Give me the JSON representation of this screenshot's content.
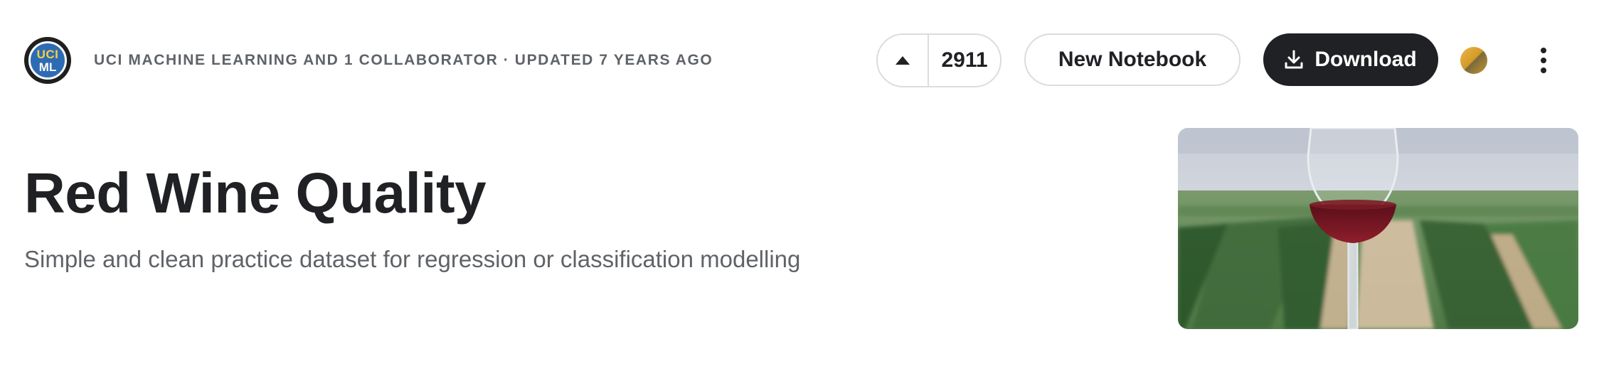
{
  "header": {
    "logo_line1": "UCI",
    "logo_line2": "ML",
    "meta": "UCI MACHINE LEARNING AND 1 COLLABORATOR · UPDATED 7 YEARS AGO"
  },
  "actions": {
    "upvote_count": "2911",
    "new_notebook_label": "New Notebook",
    "download_label": "Download"
  },
  "dataset": {
    "title": "Red Wine Quality",
    "subtitle": "Simple and clean practice dataset for regression or classification modelling"
  },
  "icons": {
    "upvote": "triangle-up-icon",
    "download": "download-icon",
    "medal": "medal-icon",
    "more": "more-vert-icon"
  },
  "colors": {
    "primary_button": "#202124",
    "border": "#dadce0",
    "muted_text": "#5f6368",
    "medal_gold": "#d49a27"
  }
}
